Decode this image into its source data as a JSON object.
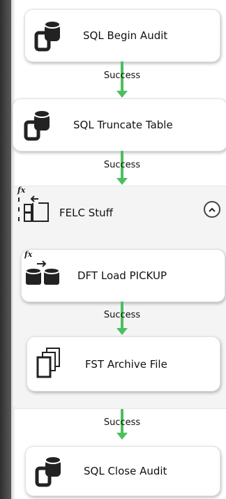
{
  "tasks": {
    "begin_audit": "SQL Begin Audit",
    "truncate_table": "SQL Truncate Table",
    "dft_load": "DFT Load PICKUP",
    "fst_archive": "FST Archive File",
    "close_audit": "SQL Close Audit"
  },
  "container": {
    "title": "FELC Stuff",
    "collapse_icon": "chevron-up-icon"
  },
  "connectors": {
    "success_1": "Success",
    "success_2": "Success",
    "success_3": "Success",
    "success_4": "Success"
  },
  "expression_marker": "fx",
  "colors": {
    "success_arrow": "#4cbf5f",
    "task_background": "#ffffff",
    "container_background": "#f4f4f4"
  }
}
